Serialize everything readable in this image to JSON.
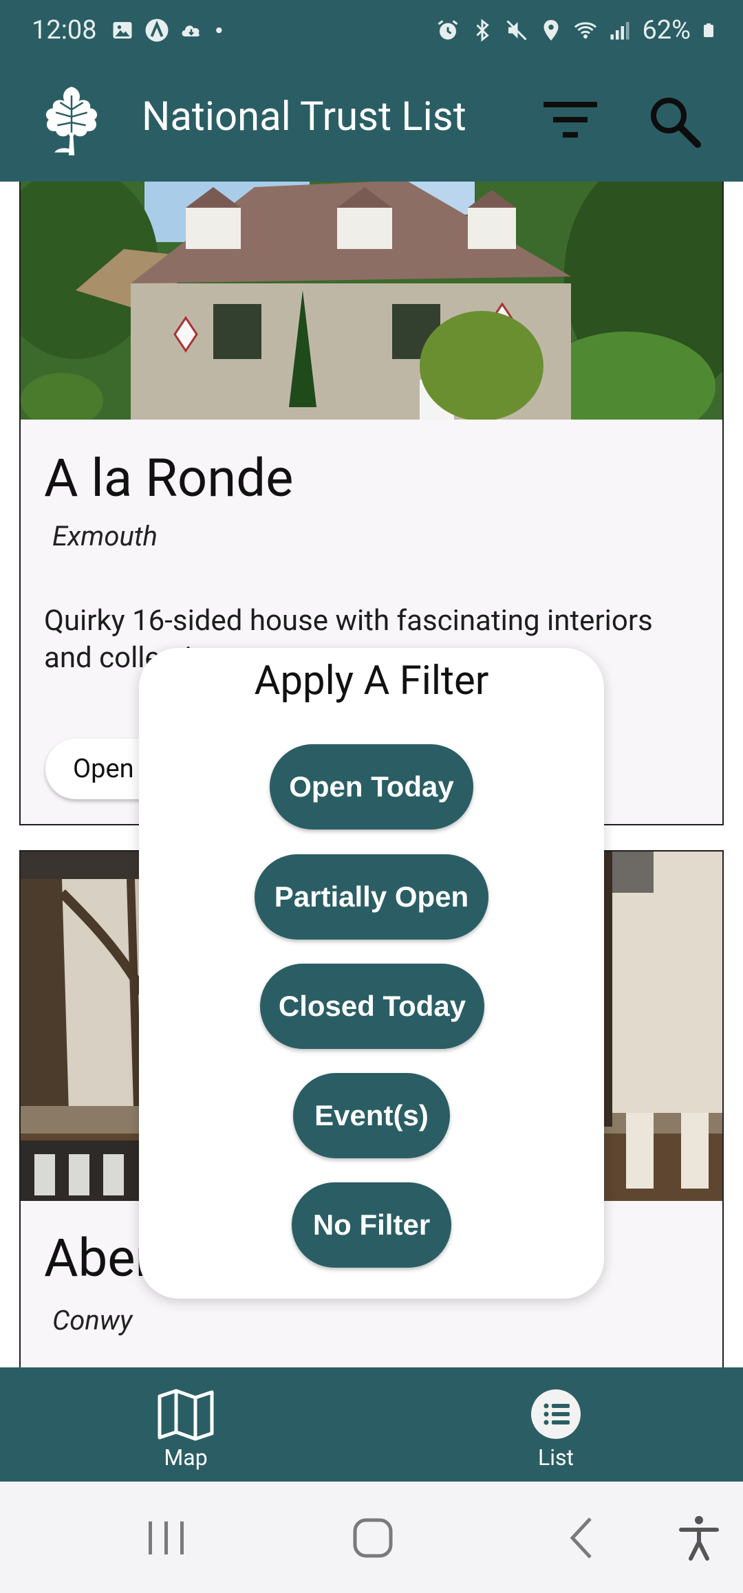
{
  "status_bar": {
    "time": "12:08",
    "battery": "62%",
    "left_icons": [
      "image-icon",
      "a-icon",
      "cloud-icon",
      "dot-icon"
    ],
    "right_icons": [
      "alarm-icon",
      "bluetooth-icon",
      "mute-icon",
      "location-icon",
      "wifi-icon",
      "signal-icon",
      "battery-icon"
    ]
  },
  "app_bar": {
    "title": "National Trust List",
    "logo": "oak-leaf-logo",
    "actions": [
      "filter-icon",
      "search-icon"
    ]
  },
  "cards": [
    {
      "title": "A la Ronde",
      "location": "Exmouth",
      "description": "Quirky 16-sided house with fascinating interiors and collections",
      "status": "Open today"
    },
    {
      "title": "Aberconwy House",
      "location": "Conwy"
    }
  ],
  "filter_dialog": {
    "title": "Apply A Filter",
    "options": [
      "Open Today",
      "Partially Open",
      "Closed Today",
      "Event(s)",
      "No Filter"
    ]
  },
  "bottom_nav": {
    "items": [
      {
        "label": "Map",
        "icon": "map-icon"
      },
      {
        "label": "List",
        "icon": "list-icon"
      }
    ]
  },
  "system_nav": [
    "recents-icon",
    "home-icon",
    "back-icon",
    "accessibility-icon"
  ],
  "colors": {
    "primary": "#2a5e64",
    "card_background": "#f8f6f8",
    "dialog_background": "#ffffff",
    "system_nav": "#f4f3f5"
  }
}
